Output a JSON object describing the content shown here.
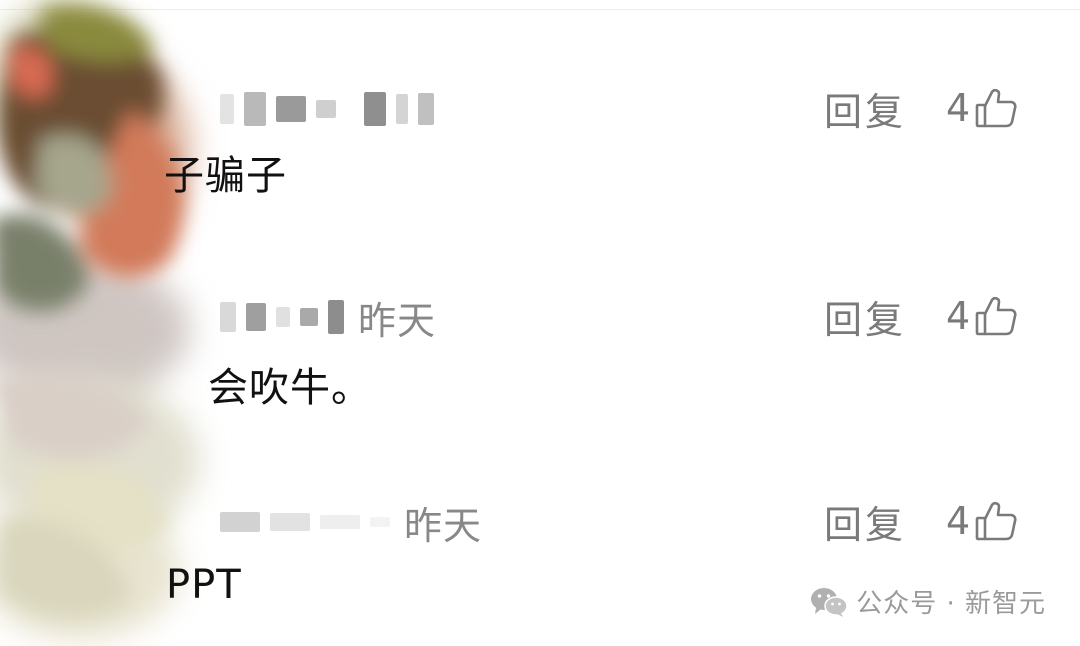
{
  "comments": [
    {
      "time": "",
      "text": "子骗子",
      "reply_label": "回复",
      "like_count": "4"
    },
    {
      "time": "昨天",
      "text": "会吹牛。",
      "reply_label": "回复",
      "like_count": "4"
    },
    {
      "time": "昨天",
      "text": "PPT",
      "reply_label": "回复",
      "like_count": "4"
    }
  ],
  "watermark": {
    "text": "公众号 · 新智元",
    "icon": "wechat-icon"
  },
  "icons": {
    "like": "thumbs-up-icon"
  },
  "colors": {
    "muted_text": "#7a7a7a",
    "body_text": "#111111",
    "background": "#ffffff"
  }
}
